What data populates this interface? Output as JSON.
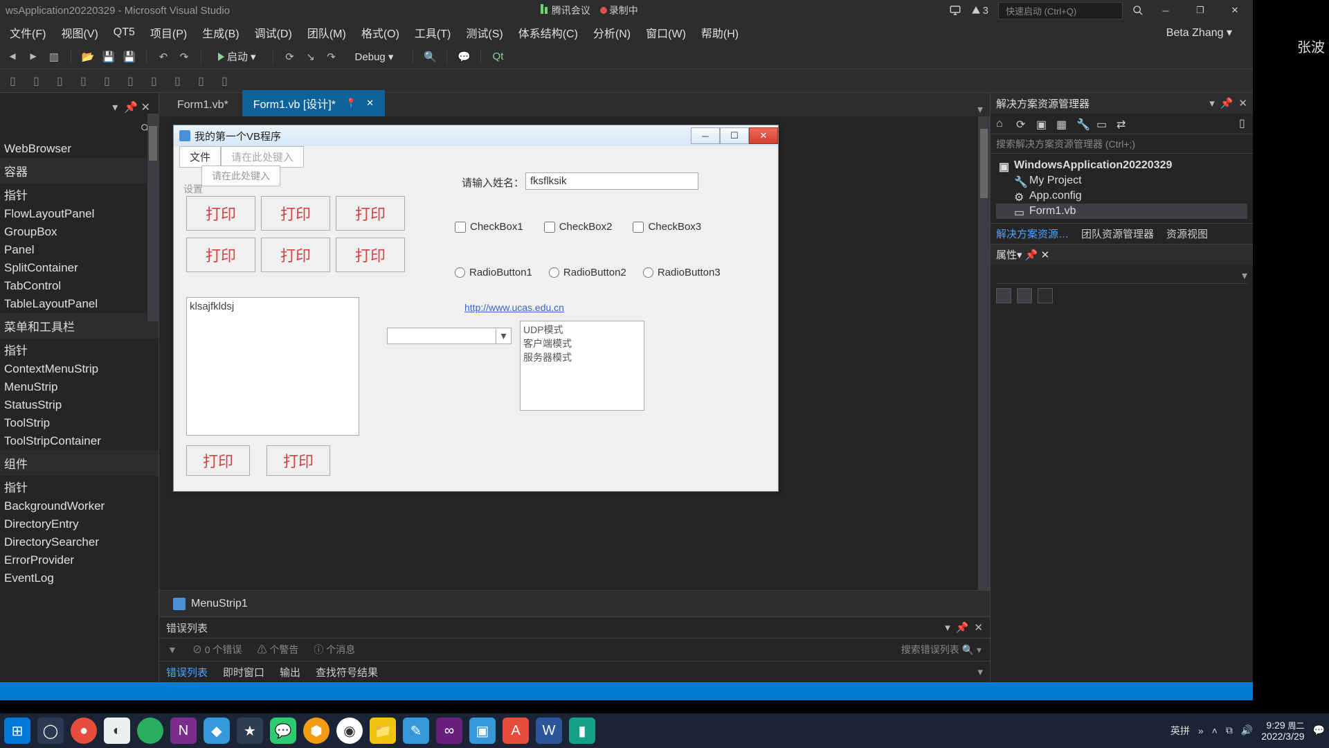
{
  "titlebar": {
    "app_title": "wsApplication20220329 - Microsoft Visual Studio",
    "meeting_label": "腾讯会议",
    "recording_label": "录制中",
    "notif_count": "3",
    "searchbox_placeholder": "快速启动 (Ctrl+Q)"
  },
  "menubar": {
    "items": [
      "文件(F)",
      "视图(V)",
      "QT5",
      "项目(P)",
      "生成(B)",
      "调试(D)",
      "团队(M)",
      "格式(O)",
      "工具(T)",
      "测试(S)",
      "体系结构(C)",
      "分析(N)",
      "窗口(W)",
      "帮助(H)"
    ],
    "user": "Beta Zhang"
  },
  "toolbar": {
    "start_label": "启动",
    "config_label": "Debug"
  },
  "doc_tabs": {
    "tab1": "Form1.vb*",
    "tab2": "Form1.vb [设计]*"
  },
  "toolbox": {
    "items_top": [
      "WebBrowser"
    ],
    "cat1": "容器",
    "items_cat1": [
      "指针",
      "FlowLayoutPanel",
      "GroupBox",
      "Panel",
      "SplitContainer",
      "TabControl",
      "TableLayoutPanel"
    ],
    "cat2": "菜单和工具栏",
    "items_cat2": [
      "指针",
      "ContextMenuStrip",
      "MenuStrip",
      "StatusStrip",
      "ToolStrip",
      "ToolStripContainer"
    ],
    "cat3": "组件",
    "items_cat3": [
      "指针",
      "BackgroundWorker",
      "DirectoryEntry",
      "DirectorySearcher",
      "ErrorProvider",
      "EventLog"
    ]
  },
  "winform": {
    "title": "我的第一个VB程序",
    "menu_item1": "文件",
    "menu_item2": "请在此处键入",
    "submenu_hint": "请在此处键入",
    "blurred_hint": "设置",
    "label_input": "请输入姓名：",
    "name_value": "fksflksik",
    "btn_label": "打印",
    "check1": "CheckBox1",
    "check2": "CheckBox2",
    "check3": "CheckBox3",
    "radio1": "RadioButton1",
    "radio2": "RadioButton2",
    "radio3": "RadioButton3",
    "big_text": "klsajfkldsj",
    "link_label": "http://www.ucas.edu.cn",
    "list_items": [
      "UDP模式",
      "客户端模式",
      "服务器模式"
    ]
  },
  "component_tray": {
    "item1": "MenuStrip1"
  },
  "errorlist": {
    "title": "错误列表",
    "errors": "0 个错误",
    "warnings": "个警告",
    "messages": "个消息",
    "search_hint": "搜索错误列表",
    "tab_active": "错误列表",
    "tab2": "即时窗口",
    "tab3": "输出",
    "tab4": "查找符号结果"
  },
  "solution": {
    "panel_title": "解决方案资源管理器",
    "search_hint": "搜索解决方案资源管理器 (Ctrl+;)",
    "project": "WindowsApplication20220329",
    "node1": "My Project",
    "node2": "App.config",
    "node3": "Form1.vb",
    "footer_tab_active": "解决方案资源…",
    "footer_tab2": "团队资源管理器",
    "footer_tab3": "资源视图"
  },
  "properties": {
    "panel_title": "属性"
  },
  "right_dark": {
    "watermark": "张波"
  },
  "taskbar": {
    "ime": "英拼",
    "time": "9:29",
    "dow": "周二",
    "date": "2022/3/29"
  }
}
